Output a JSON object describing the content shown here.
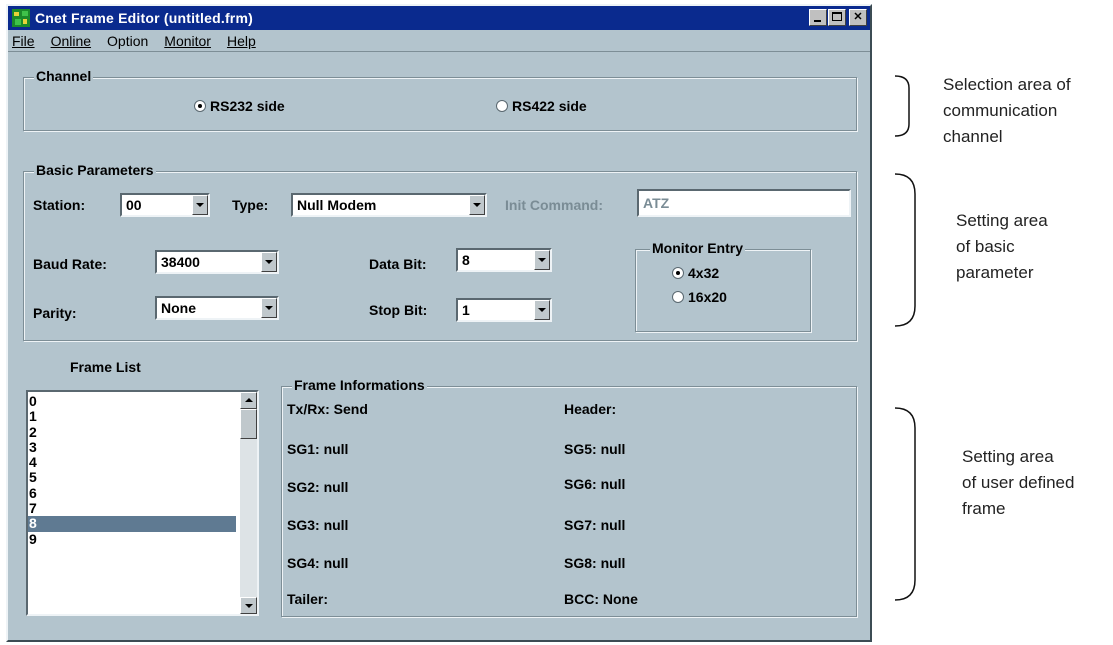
{
  "window": {
    "title": "Cnet Frame Editor (untitled.frm)"
  },
  "menu": [
    "File",
    "Online",
    "Option",
    "Monitor",
    "Help"
  ],
  "channel": {
    "label": "Channel",
    "options": [
      "RS232 side",
      "RS422 side"
    ],
    "selected": "RS232 side"
  },
  "basic": {
    "label": "Basic Parameters",
    "station_label": "Station:",
    "station_value": "00",
    "type_label": "Type:",
    "type_value": "Null Modem",
    "init_label": "Init Command:",
    "init_value": "ATZ",
    "baud_label": "Baud Rate:",
    "baud_value": "38400",
    "databit_label": "Data Bit:",
    "databit_value": "8",
    "parity_label": "Parity:",
    "parity_value": "None",
    "stopbit_label": "Stop Bit:",
    "stopbit_value": "1",
    "monitor": {
      "label": "Monitor Entry",
      "options": [
        "4x32",
        "16x20"
      ],
      "selected": "4x32"
    }
  },
  "frame_list": {
    "label": "Frame List",
    "items": [
      "0",
      "1",
      "2",
      "3",
      "4",
      "5",
      "6",
      "7",
      "8",
      "9"
    ],
    "selected": "8"
  },
  "frame_info": {
    "label": "Frame Informations",
    "txrx": "Tx/Rx: Send",
    "header": "Header:",
    "sg1": "SG1: null",
    "sg2": "SG2: null",
    "sg3": "SG3: null",
    "sg4": "SG4: null",
    "sg5": "SG5: null",
    "sg6": "SG6: null",
    "sg7": "SG7: null",
    "sg8": "SG8: null",
    "tailer": "Tailer:",
    "bcc": "BCC: None"
  },
  "annotations": {
    "channel": [
      "Selection area of",
      "communication",
      "channel"
    ],
    "basic": [
      "Setting area",
      "of basic",
      "parameter"
    ],
    "frame": [
      "Setting area",
      "of user defined",
      "frame"
    ]
  },
  "colors": {
    "titlebar": "#0a2a8e",
    "window_bg": "#b3c4cd",
    "list_selection": "#5f7a92"
  }
}
